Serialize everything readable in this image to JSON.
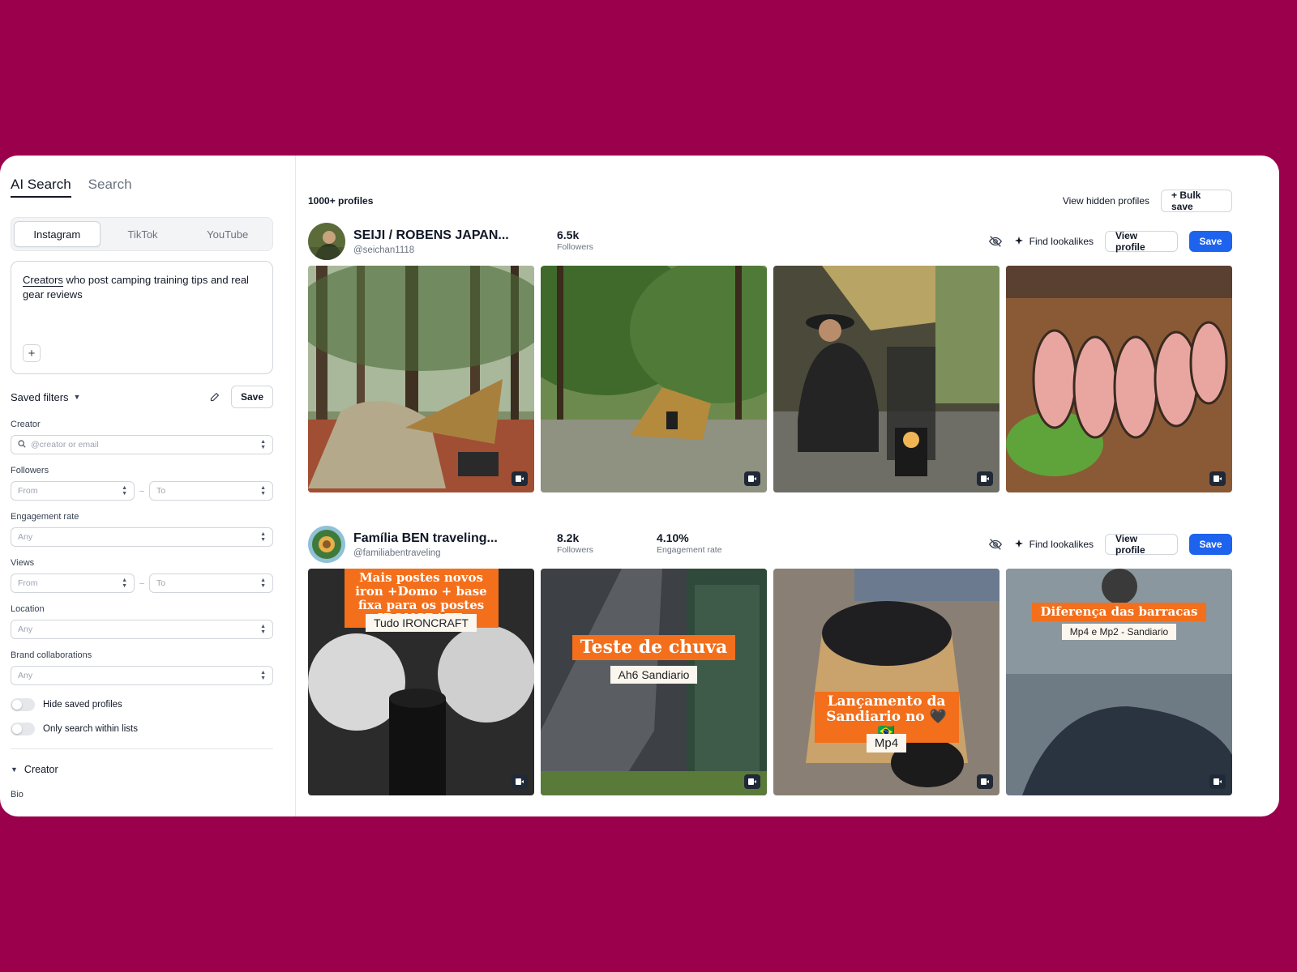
{
  "sidebar": {
    "mode_tabs": [
      "AI Search",
      "Search"
    ],
    "platforms": [
      "Instagram",
      "TikTok",
      "YouTube"
    ],
    "prompt": {
      "underlined": "Creators",
      "rest": " who post camping training tips and real gear reviews",
      "add_symbol": "+"
    },
    "saved_filters_label": "Saved filters",
    "save_label": "Save",
    "filters": {
      "creator_label": "Creator",
      "creator_placeholder": "@creator or email",
      "followers_label": "Followers",
      "followers_from": "From",
      "followers_to": "To",
      "engagement_label": "Engagement rate",
      "engagement_value": "Any",
      "views_label": "Views",
      "views_from": "From",
      "views_to": "To",
      "location_label": "Location",
      "location_value": "Any",
      "brand_label": "Brand collaborations",
      "brand_value": "Any",
      "range_dash": "–"
    },
    "toggles": [
      "Hide saved profiles",
      "Only search within lists"
    ],
    "section_creator": "Creator",
    "bio_label": "Bio"
  },
  "main": {
    "count": "1000+ profiles",
    "view_hidden": "View hidden profiles",
    "bulk_save": "+ Bulk save",
    "find_lookalikes": "Find lookalikes",
    "view_profile": "View profile",
    "save": "Save",
    "profiles": [
      {
        "name": "SEIJI / ROBENS JAPAN...",
        "handle": "@seichan1118",
        "followers": "6.5k",
        "followers_label": "Followers"
      },
      {
        "name": "Família BEN traveling...",
        "handle": "@familiabentraveling",
        "followers": "8.2k",
        "followers_label": "Followers",
        "engagement": "4.10%",
        "engagement_label": "Engagement rate",
        "post_overlays": {
          "p1_orange": "Mais postes novos iron +Domo + base fixa para os postes IRONCRAFT.",
          "p1_white": "Tudo IRONCRAFT",
          "p2_orange": "Teste de chuva",
          "p2_white": "Ah6 Sandiario",
          "p3_orange": "Lançamento da Sandiario no 🖤🇧🇷",
          "p3_white": "Mp4",
          "p4_orange": "Diferença das barracas",
          "p4_white": "Mp4 e Mp2 - Sandiario"
        }
      }
    ]
  },
  "colors": {
    "background": "#9b004c",
    "accent": "#1d63ed",
    "overlay_orange": "#f36f1b"
  }
}
